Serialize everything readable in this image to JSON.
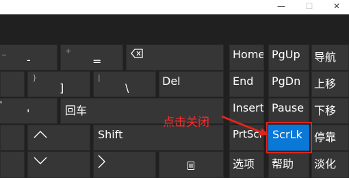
{
  "window": {
    "minimize_icon": "minimize-icon",
    "maximize_icon": "maximize-icon",
    "close_icon": "close-icon"
  },
  "keyboard": {
    "row1": {
      "minus": "-",
      "minus_small": "_",
      "equals": "=",
      "equals_small": "+",
      "backspace_icon": "backspace-icon"
    },
    "row2": {
      "bracket": "]",
      "bracket_small": "}",
      "backslash": "\\",
      "backslash_small": "|",
      "del": "Del"
    },
    "row3": {
      "quote": "'",
      "quote_small": "\"",
      "enter": "回车"
    },
    "row4": {
      "up_icon": "up-arrow-icon",
      "shift": "Shift"
    },
    "row5": {
      "down_icon": "down-arrow-icon",
      "right_icon": "right-arrow-icon",
      "menu_icon": "menu-icon"
    }
  },
  "nav": {
    "home": "Home",
    "pgup": "PgUp",
    "nav": "导航",
    "end": "End",
    "pgdn": "PgDn",
    "up": "上移",
    "insert": "Insert",
    "pause": "Pause",
    "down": "下移",
    "prtscn": "PrtScn",
    "scrlk": "ScrLk",
    "dock": "停靠",
    "options": "选项",
    "help": "帮助",
    "fade": "淡化"
  },
  "annotation": {
    "text": "点击关闭",
    "color": "#e0251b"
  },
  "colors": {
    "accent": "#0a78d7",
    "key": "#363636",
    "background": "#202020"
  }
}
